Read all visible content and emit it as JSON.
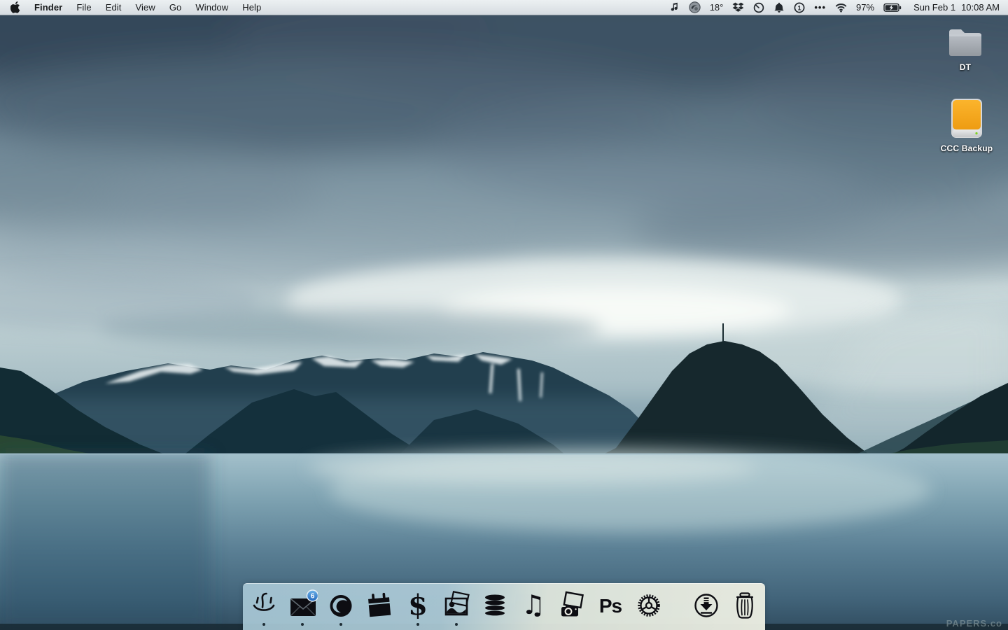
{
  "menu_bar": {
    "menus": [
      "Finder",
      "File",
      "Edit",
      "View",
      "Go",
      "Window",
      "Help"
    ],
    "status": {
      "icons": [
        "music-icon",
        "weather-app-icon",
        "dropbox-icon",
        "do-not-disturb-icon",
        "notifications-bell-icon",
        "onepassword-icon",
        "more-dots-icon",
        "wifi-icon",
        "battery-charging-icon"
      ],
      "temperature": "18°",
      "more_dots": "•••",
      "onepassword_digit": "1",
      "battery_percent": "97%",
      "date": "Sun Feb 1",
      "time": "10:08 AM"
    }
  },
  "desktop": {
    "icons": [
      {
        "label": "DT",
        "type": "folder"
      },
      {
        "label": "CCC Backup",
        "type": "external-drive"
      }
    ],
    "watermark": "PAPERS.co"
  },
  "dock": {
    "items": [
      {
        "name": "finder",
        "running": true
      },
      {
        "name": "mail",
        "running": true,
        "badge": "6"
      },
      {
        "name": "firefox",
        "running": true
      },
      {
        "name": "calendar",
        "running": false
      },
      {
        "name": "money-app",
        "running": true,
        "glyph": "$"
      },
      {
        "name": "photos",
        "running": true
      },
      {
        "name": "database-app",
        "running": false
      },
      {
        "name": "itunes",
        "running": false,
        "glyph": "♫"
      },
      {
        "name": "image-capture",
        "running": false
      },
      {
        "name": "photoshop",
        "running": false,
        "glyph": "Ps"
      },
      {
        "name": "system-preferences",
        "running": false
      },
      {
        "name": "downloads",
        "running": false
      },
      {
        "name": "trash",
        "running": false
      }
    ]
  },
  "colors": {
    "badge_blue": "#2f7fd4",
    "drive_orange": "#f6a71f",
    "folder_gray": "#a9afb6",
    "dock_icon": "#0d0d12"
  }
}
